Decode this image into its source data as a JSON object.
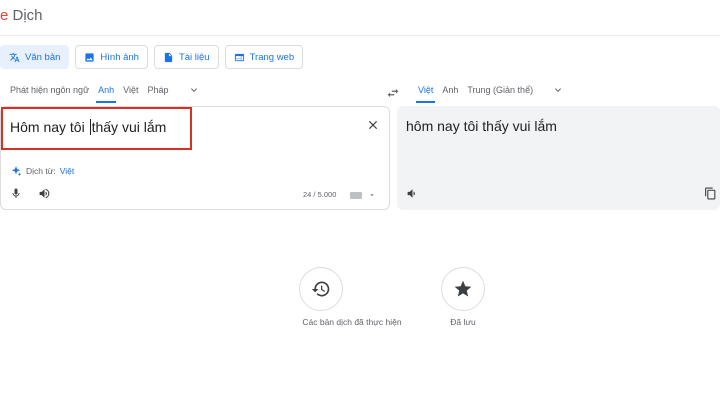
{
  "app": {
    "logo_tail": "e",
    "logo_text": " Dịch"
  },
  "modes": [
    {
      "label": "Văn bản",
      "icon": "translate-icon"
    },
    {
      "label": "Hình ảnh",
      "icon": "image-icon"
    },
    {
      "label": "Tài liệu",
      "icon": "document-icon"
    },
    {
      "label": "Trang web",
      "icon": "web-icon"
    }
  ],
  "source_langs": {
    "detect": "Phát hiện ngôn ngữ",
    "l1": "Anh",
    "l2": "Việt",
    "l3": "Pháp"
  },
  "target_langs": {
    "l1": "Việt",
    "l2": "Anh",
    "l3": "Trung (Giản thể)"
  },
  "source": {
    "text_before_caret": "Hôm nay tôi ",
    "text_after_caret": "thấy vui lắm",
    "detected_prefix": "Dịch từ: ",
    "detected_lang": "Việt",
    "char_count": "24 / 5.000"
  },
  "target": {
    "text": "hôm nay tôi thấy vui lắm"
  },
  "bottom": {
    "history_label": "Các bản dịch đã thực hiện",
    "saved_label": "Đã lưu"
  },
  "colors": {
    "accent": "#1a73e8",
    "highlight_box": "#d93025"
  }
}
